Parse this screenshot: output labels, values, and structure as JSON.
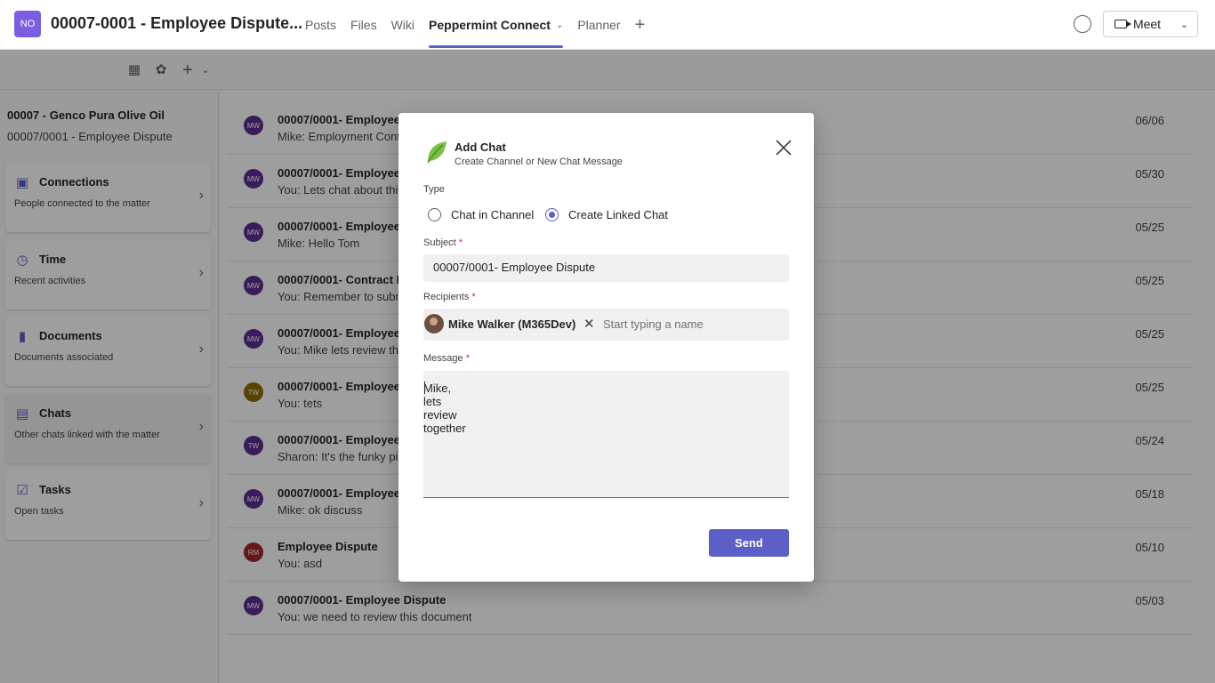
{
  "header": {
    "team_initials": "NO",
    "team_title": "00007-0001 - Employee Dispute...",
    "tabs": [
      {
        "label": "Posts"
      },
      {
        "label": "Files"
      },
      {
        "label": "Wiki"
      },
      {
        "label": "Peppermint Connect"
      },
      {
        "label": "Planner"
      }
    ],
    "meet_label": "Meet",
    "accent": "#5b5fc7"
  },
  "toolbar": {
    "icons": [
      "teams-icon",
      "leaf-icon",
      "plus-icon",
      "chevron-down-icon"
    ]
  },
  "sidebar": {
    "matter_title": "00007 - Genco Pura Olive Oil",
    "matter_sub": "00007/0001 - Employee Dispute",
    "cards": [
      {
        "title": "Connections",
        "sub": "People connected to the matter",
        "icon": "contact-card-icon"
      },
      {
        "title": "Time",
        "sub": "Recent activities",
        "icon": "clock-icon"
      },
      {
        "title": "Documents",
        "sub": "Documents associated",
        "icon": "document-icon"
      },
      {
        "title": "Chats",
        "sub": "Other chats linked with the matter",
        "icon": "chat-icon"
      },
      {
        "title": "Tasks",
        "sub": "Open tasks",
        "icon": "clipboard-icon"
      }
    ]
  },
  "chats": [
    {
      "initials": "MW",
      "title": "00007/0001- Employee",
      "msg": "Mike: Employment Cont",
      "date": "06/06",
      "color": "#5c2e91"
    },
    {
      "initials": "MW",
      "title": "00007/0001- Employee",
      "msg": "You: Lets chat about thi",
      "date": "05/30",
      "color": "#5c2e91"
    },
    {
      "initials": "MW",
      "title": "00007/0001- Employee",
      "msg": "Mike: Hello Tom",
      "date": "05/25",
      "color": "#5c2e91"
    },
    {
      "initials": "MW",
      "title": "00007/0001- Contract F",
      "msg": "You: Remember to subn",
      "date": "05/25",
      "color": "#5c2e91"
    },
    {
      "initials": "MW",
      "title": "00007/0001- Employee",
      "msg": "You: Mike lets review th",
      "date": "05/25",
      "color": "#5c2e91"
    },
    {
      "initials": "TW",
      "title": "00007/0001- Employee",
      "msg": "You: tets",
      "date": "05/25",
      "color": "#8f6e00"
    },
    {
      "initials": "TW",
      "title": "00007/0001- Employee",
      "msg": "Sharon: It's the funky pi",
      "date": "05/24",
      "color": "#5c2e91"
    },
    {
      "initials": "MW",
      "title": "00007/0001- Employee",
      "msg": "Mike: ok discuss",
      "date": "05/18",
      "color": "#5c2e91"
    },
    {
      "initials": "RM",
      "title": "Employee Dispute",
      "msg": "You: asd",
      "date": "05/10",
      "color": "#a4262c"
    },
    {
      "initials": "MW",
      "title": "00007/0001- Employee Dispute",
      "msg": "You: we need to review this document",
      "date": "05/03",
      "color": "#5c2e91"
    }
  ],
  "dialog": {
    "title": "Add Chat",
    "subtitle": "Create Channel or New Chat Message",
    "type_label": "Type",
    "option_channel": "Chat in Channel",
    "option_linked": "Create Linked Chat",
    "selected_option": "Create Linked Chat",
    "subject_label": "Subject",
    "subject_value": "00007/0001- Employee Dispute",
    "recipients_label": "Recipients",
    "recipient_name": "Mike Walker (M365Dev)",
    "recipient_placeholder": "Start typing a name",
    "message_label": "Message",
    "message_value": "Mike, lets review together",
    "required_mark": "*",
    "send_label": "Send"
  }
}
